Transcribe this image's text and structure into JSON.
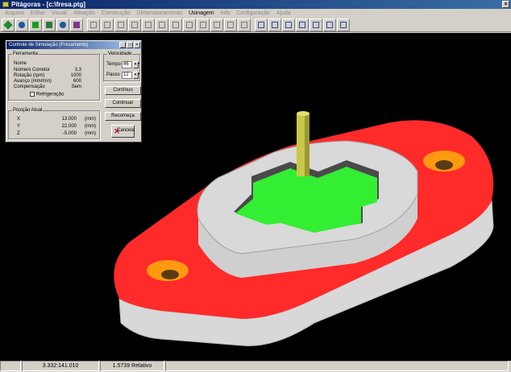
{
  "window": {
    "title": "Pitágoras - [c:\\fresa.ptg]"
  },
  "menu": [
    {
      "label": "Arquivo",
      "active": false
    },
    {
      "label": "Editar",
      "active": false
    },
    {
      "label": "Visual",
      "active": false
    },
    {
      "label": "Ativação",
      "active": false
    },
    {
      "label": "Construção",
      "active": false
    },
    {
      "label": "Dimensionamento",
      "active": false
    },
    {
      "label": "Usinagem",
      "active": true
    },
    {
      "label": "Info",
      "active": false
    },
    {
      "label": "Configuração",
      "active": false
    },
    {
      "label": "Ajuda",
      "active": false
    }
  ],
  "dialog": {
    "title": "Controle de Simulação (Fresamento)",
    "ferramenta": {
      "title": "Ferramenta",
      "nome_label": "Nome",
      "rows": [
        {
          "label": "Número Corretor",
          "value": "3,3"
        },
        {
          "label": "Rotação (rpm)",
          "value": "1000"
        },
        {
          "label": "Avanço (mm/min)",
          "value": "600"
        },
        {
          "label": "Compensação",
          "value": "Sem"
        }
      ],
      "refrigeracao_label": "Refrigeração"
    },
    "velocidade": {
      "title": "Velocidade",
      "tempo_label": "Tempo",
      "tempo_value": "46",
      "passo_label": "Passo",
      "passo_value": "12"
    },
    "buttons": {
      "continuo": "Contínuo",
      "continuar": "Continuar",
      "recomeca": "Recomeça",
      "cancela": "Cancela"
    },
    "posicao": {
      "title": "Posição Atual",
      "rows": [
        {
          "axis": "X",
          "value": "13.000",
          "unit": "(mm)"
        },
        {
          "axis": "Y",
          "value": "22.000",
          "unit": "(mm)"
        },
        {
          "axis": "Z",
          "value": "-5.000",
          "unit": "(mm)"
        }
      ]
    }
  },
  "status": {
    "coords": "3.332:141.010",
    "relative": "1.5739 Relativo"
  },
  "colors": {
    "part_top": "#ff2a2a",
    "part_side": "#d8d8d8",
    "pocket_floor": "#33ee33",
    "tool": "#c8c84a",
    "hole": "#ff9a10"
  }
}
